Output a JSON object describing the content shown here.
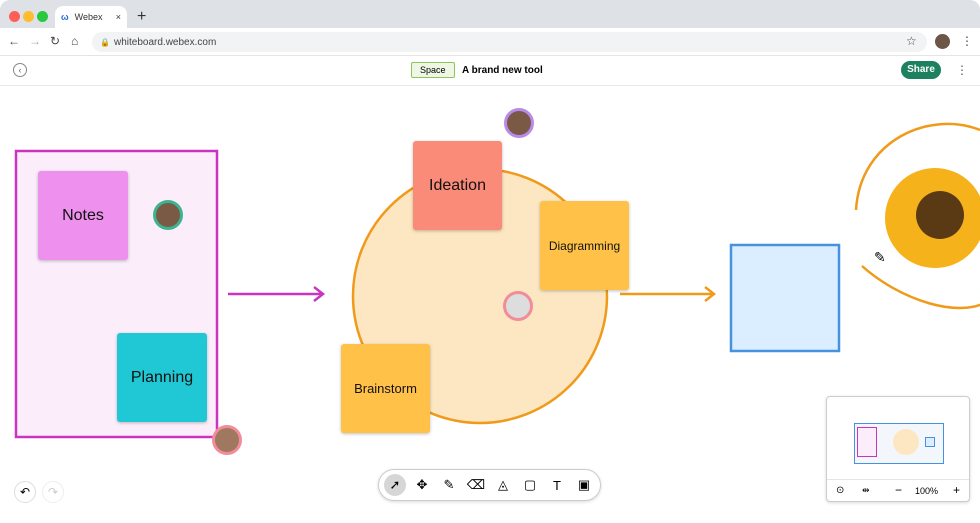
{
  "browser": {
    "tab_title": "Webex",
    "url": "whiteboard.webex.com"
  },
  "header": {
    "space_badge": "Space",
    "title": "A brand new tool",
    "share_label": "Share"
  },
  "canvas": {
    "stickies": {
      "notes": "Notes",
      "planning": "Planning",
      "ideation": "Ideation",
      "diagramming": "Diagramming",
      "brainstorm": "Brainstorm"
    }
  },
  "colors": {
    "accent": "#1d805f",
    "frame": "#c935c0",
    "orange": "#f09a1a",
    "blue": "#4593e0"
  },
  "minimap": {
    "zoom": "100%"
  },
  "toolbar": {
    "tools": [
      "select",
      "move",
      "pen",
      "eraser",
      "shapes",
      "sticky-note",
      "text",
      "image"
    ]
  }
}
